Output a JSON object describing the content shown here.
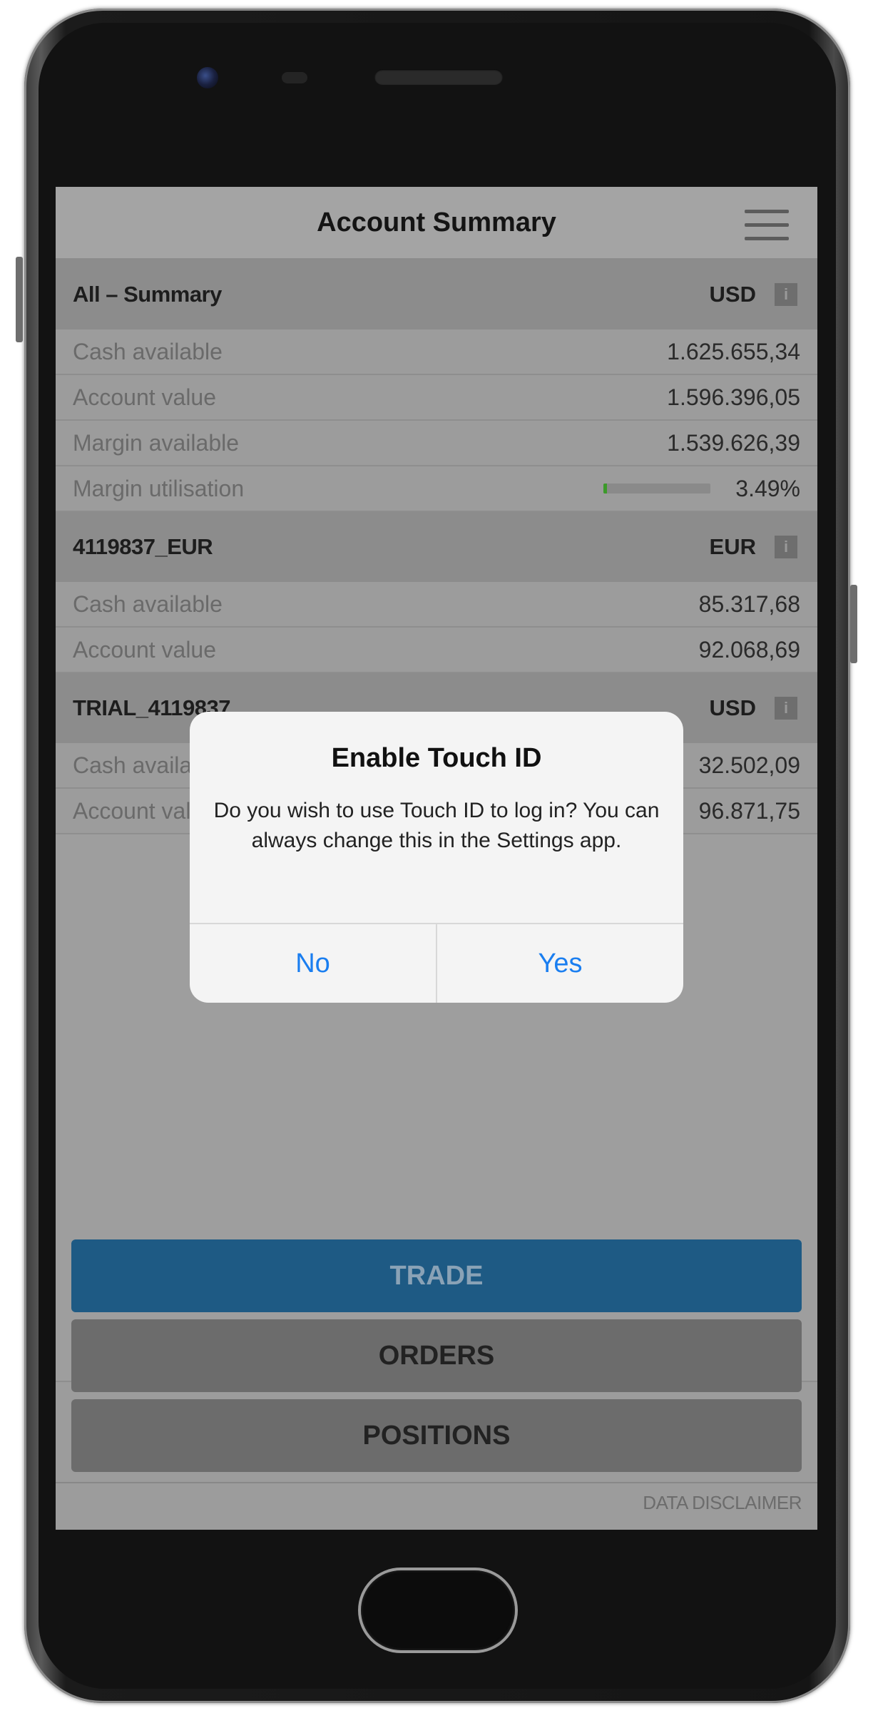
{
  "header": {
    "title": "Account Summary"
  },
  "accounts": [
    {
      "name": "All – Summary",
      "currency": "USD",
      "info_icon": "info-icon",
      "rows": [
        {
          "label": "Cash available",
          "value": "1.625.655,34"
        },
        {
          "label": "Account value",
          "value": "1.596.396,05"
        },
        {
          "label": "Margin available",
          "value": "1.539.626,39"
        },
        {
          "label": "Margin utilisation",
          "value": "3.49%",
          "meter_fraction": 0.0349
        }
      ]
    },
    {
      "name": "4119837_EUR",
      "currency": "EUR",
      "info_icon": "info-icon",
      "rows": [
        {
          "label": "Cash available",
          "value": "85.317,68"
        },
        {
          "label": "Account value",
          "value": "92.068,69"
        }
      ]
    },
    {
      "name": "TRIAL_4119837",
      "currency": "USD",
      "info_icon": "info-icon",
      "rows": [
        {
          "label": "Cash available",
          "value": "32.502,09"
        },
        {
          "label": "Account value",
          "value": "96.871,75"
        }
      ]
    }
  ],
  "buttons": {
    "trade": "TRADE",
    "orders": "ORDERS",
    "positions": "POSITIONS"
  },
  "footer": {
    "disclaimer": "DATA DISCLAIMER"
  },
  "dialog": {
    "title": "Enable Touch ID",
    "message": "Do you wish to use Touch ID to log in? You can always change this in the Settings app.",
    "no_label": "No",
    "yes_label": "Yes"
  },
  "colors": {
    "trade_button": "#1e5a84",
    "dialog_button_text": "#1a7ef0",
    "meter_fill": "#3c9a2a"
  }
}
